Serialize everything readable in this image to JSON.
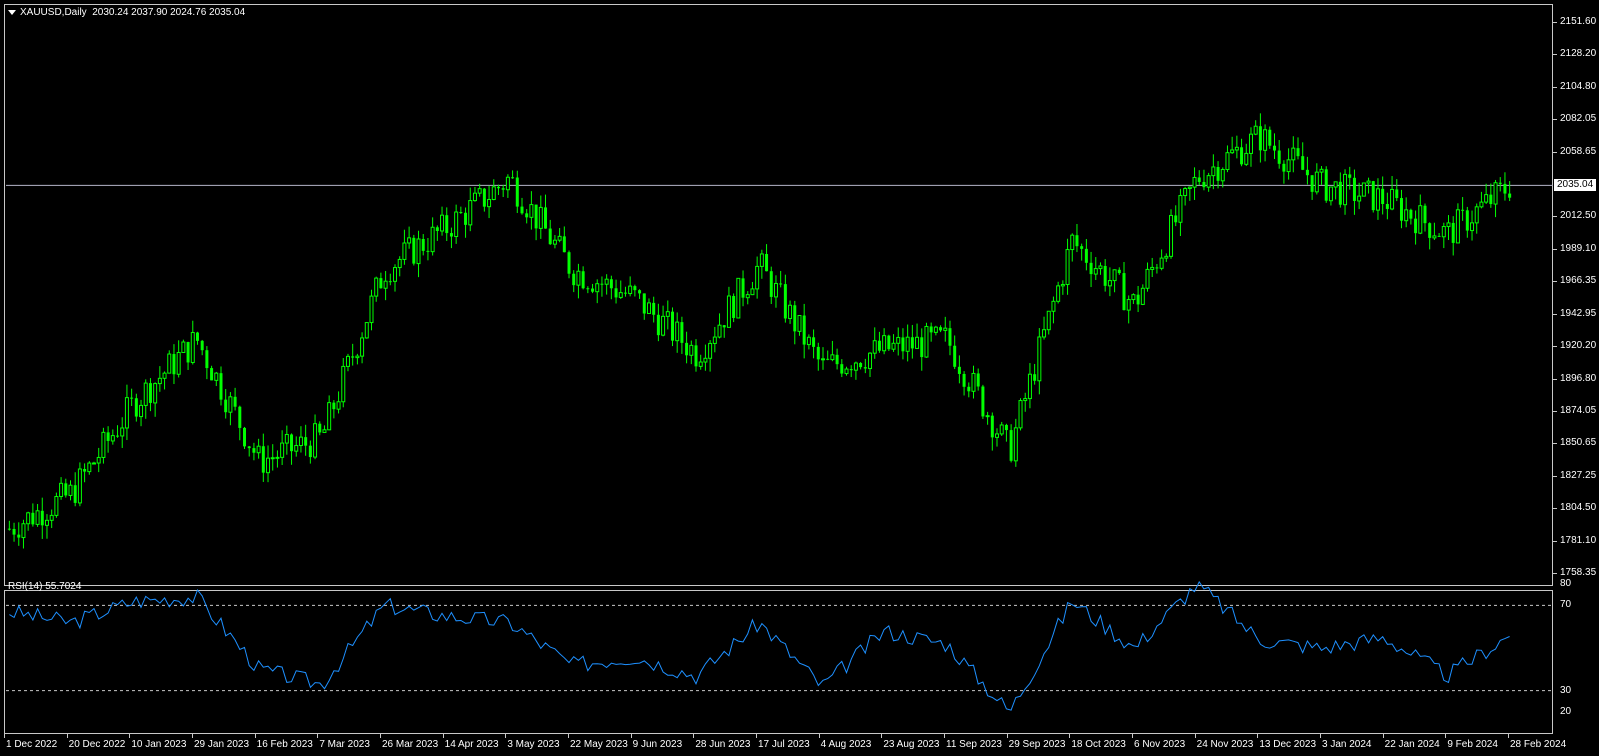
{
  "symbol_header": {
    "title": "XAUUSD,Daily",
    "ohlc": "2030.24 2037.90 2024.76 2035.04"
  },
  "rsi_header": {
    "title": "RSI(14) 55.7024"
  },
  "colors": {
    "background": "#000000",
    "bull_candle": "#00ff00",
    "bear_candle": "#00ff00",
    "rsi_line": "#1e90ff",
    "current_price_line": "#b4b4c8",
    "grid_frame": "#c8c8c8"
  },
  "price_axis": {
    "labels": [
      "2151.60",
      "2128.20",
      "2104.80",
      "2082.05",
      "2058.65",
      "2035.04",
      "2012.50",
      "1989.10",
      "1966.35",
      "1942.95",
      "1920.20",
      "1896.80",
      "1874.05",
      "1850.65",
      "1827.25",
      "1804.50",
      "1781.10",
      "1758.35"
    ],
    "current_price": "2035.04",
    "ylim": [
      1758.35,
      2151.6
    ]
  },
  "rsi_axis": {
    "labels": [
      "80",
      "70",
      "30",
      "20"
    ],
    "levels": [
      70,
      30
    ],
    "ylim": [
      20,
      80
    ]
  },
  "time_axis": {
    "labels": [
      "1 Dec 2022",
      "20 Dec 2022",
      "10 Jan 2023",
      "29 Jan 2023",
      "16 Feb 2023",
      "7 Mar 2023",
      "26 Mar 2023",
      "14 Apr 2023",
      "3 May 2023",
      "22 May 2023",
      "9 Jun 2023",
      "28 Jun 2023",
      "17 Jul 2023",
      "4 Aug 2023",
      "23 Aug 2023",
      "11 Sep 2023",
      "29 Sep 2023",
      "18 Oct 2023",
      "6 Nov 2023",
      "24 Nov 2023",
      "13 Dec 2023",
      "3 Jan 2024",
      "22 Jan 2024",
      "9 Feb 2024",
      "28 Feb 2024"
    ]
  },
  "chart_data": [
    {
      "type": "candlestick",
      "title": "XAUUSD,Daily",
      "series": [
        {
          "name": "XAUUSD",
          "x": [
            "1 Dec 2022",
            "20 Dec 2022",
            "10 Jan 2023",
            "29 Jan 2023",
            "16 Feb 2023",
            "7 Mar 2023",
            "26 Mar 2023",
            "14 Apr 2023",
            "3 May 2023",
            "22 May 2023",
            "9 Jun 2023",
            "28 Jun 2023",
            "17 Jul 2023",
            "4 Aug 2023",
            "23 Aug 2023",
            "11 Sep 2023",
            "29 Sep 2023",
            "18 Oct 2023",
            "6 Nov 2023",
            "24 Nov 2023",
            "13 Dec 2023",
            "3 Jan 2024",
            "22 Jan 2024",
            "9 Feb 2024",
            "28 Feb 2024"
          ],
          "close": [
            1790,
            1815,
            1880,
            1925,
            1838,
            1855,
            1975,
            2005,
            2040,
            1975,
            1955,
            1915,
            1978,
            1905,
            1918,
            1925,
            1845,
            1995,
            1950,
            2040,
            2070,
            2035,
            2025,
            2000,
            2035
          ]
        }
      ],
      "ylim": [
        1758.35,
        2151.6
      ]
    },
    {
      "type": "line",
      "title": "RSI(14) 55.7024",
      "series": [
        {
          "name": "RSI(14)",
          "x": [
            "1 Dec 2022",
            "20 Dec 2022",
            "10 Jan 2023",
            "29 Jan 2023",
            "16 Feb 2023",
            "7 Mar 2023",
            "26 Mar 2023",
            "14 Apr 2023",
            "3 May 2023",
            "22 May 2023",
            "9 Jun 2023",
            "28 Jun 2023",
            "17 Jul 2023",
            "4 Aug 2023",
            "23 Aug 2023",
            "11 Sep 2023",
            "29 Sep 2023",
            "18 Oct 2023",
            "6 Nov 2023",
            "24 Nov 2023",
            "13 Dec 2023",
            "3 Jan 2024",
            "22 Jan 2024",
            "9 Feb 2024",
            "28 Feb 2024"
          ],
          "values": [
            67,
            62,
            72,
            74,
            40,
            33,
            70,
            65,
            62,
            42,
            46,
            37,
            62,
            32,
            58,
            52,
            20,
            72,
            50,
            80,
            54,
            50,
            55,
            37,
            56
          ]
        }
      ],
      "levels": [
        70,
        30
      ],
      "ylim": [
        20,
        80
      ]
    }
  ]
}
